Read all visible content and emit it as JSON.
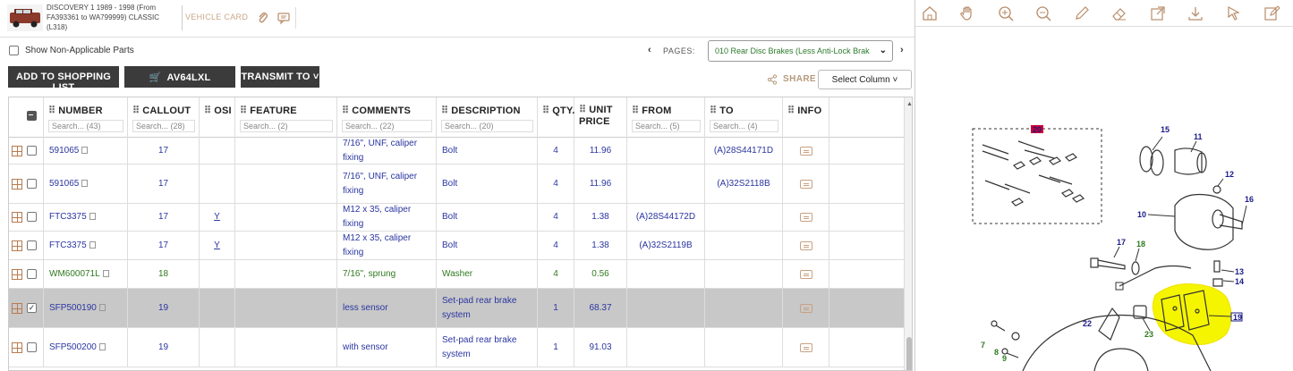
{
  "header": {
    "vehicle_title": "DISCOVERY 1 1989 - 1998 (From FA393361 to WA799999) CLASSIC (L318)",
    "vehicle_card": "VEHICLE CARD"
  },
  "controls": {
    "show_non_applicable": "Show Non-Applicable Parts",
    "pages_label": "PAGES:",
    "pages_value": "010 Rear Disc Brakes (Less Anti-Lock Brak",
    "prev_arrow": "‹",
    "next_arrow": "›",
    "add_to_list": "ADD TO SHOPPING LIST",
    "cart_ref": "AV64LXL",
    "transmit": "TRANSMIT TO ˅",
    "share": "SHARE",
    "select_column": "Select Column ˅"
  },
  "columns": [
    {
      "key": "number",
      "label": "NUMBER",
      "search": "Search... (43)"
    },
    {
      "key": "callout",
      "label": "CALLOUT",
      "search": "Search... (28)"
    },
    {
      "key": "osi",
      "label": "OSI",
      "search": ""
    },
    {
      "key": "feature",
      "label": "FEATURE",
      "search": "Search... (2)"
    },
    {
      "key": "comments",
      "label": "COMMENTS",
      "search": "Search... (22)"
    },
    {
      "key": "description",
      "label": "DESCRIPTION",
      "search": "Search... (20)"
    },
    {
      "key": "qty",
      "label": "QTY.",
      "search": ""
    },
    {
      "key": "price",
      "label": "UNIT PRICE",
      "search": ""
    },
    {
      "key": "from",
      "label": "FROM",
      "search": "Search... (5)"
    },
    {
      "key": "to",
      "label": "TO",
      "search": "Search... (4)"
    },
    {
      "key": "info",
      "label": "INFO",
      "search": ""
    }
  ],
  "rows": [
    {
      "number": "591065",
      "callout": "17",
      "osi": "",
      "feature": "",
      "comments": "7/16\", UNF, caliper fixing",
      "description": "Bolt",
      "qty": "4",
      "price": "11.96",
      "from": "",
      "to": "(A)28S44171D",
      "color": "blue",
      "checked": false
    },
    {
      "number": "591065",
      "callout": "17",
      "osi": "",
      "feature": "",
      "comments": "7/16\", UNF, caliper fixing",
      "description": "Bolt",
      "qty": "4",
      "price": "11.96",
      "from": "",
      "to": "(A)32S2118B",
      "color": "blue",
      "checked": false
    },
    {
      "number": "FTC3375",
      "callout": "17",
      "osi": "Y",
      "feature": "",
      "comments": "M12 x 35, caliper fixing",
      "description": "Bolt",
      "qty": "4",
      "price": "1.38",
      "from": "(A)28S44172D",
      "to": "",
      "color": "blue",
      "checked": false
    },
    {
      "number": "FTC3375",
      "callout": "17",
      "osi": "Y",
      "feature": "",
      "comments": "M12 x 35, caliper fixing",
      "description": "Bolt",
      "qty": "4",
      "price": "1.38",
      "from": "(A)32S2119B",
      "to": "",
      "color": "blue",
      "checked": false
    },
    {
      "number": "WM600071L",
      "callout": "18",
      "osi": "",
      "feature": "",
      "comments": "7/16\", sprung",
      "description": "Washer",
      "qty": "4",
      "price": "0.56",
      "from": "",
      "to": "",
      "color": "green",
      "checked": false
    },
    {
      "number": "SFP500190",
      "callout": "19",
      "osi": "",
      "feature": "",
      "comments": "less sensor",
      "description": "Set-pad rear brake system",
      "qty": "1",
      "price": "68.37",
      "from": "",
      "to": "",
      "color": "blue",
      "checked": true
    },
    {
      "number": "SFP500200",
      "callout": "19",
      "osi": "",
      "feature": "",
      "comments": "with sensor",
      "description": "Set-pad rear brake system",
      "qty": "1",
      "price": "91.03",
      "from": "",
      "to": "",
      "color": "blue",
      "checked": false
    }
  ],
  "diagram": {
    "callouts": [
      "20",
      "15",
      "11",
      "12",
      "16",
      "10",
      "17",
      "18",
      "13",
      "14",
      "19",
      "22",
      "23",
      "7",
      "8",
      "9"
    ],
    "highlight_color": "#f5f500",
    "box_color": "#cc0033"
  }
}
